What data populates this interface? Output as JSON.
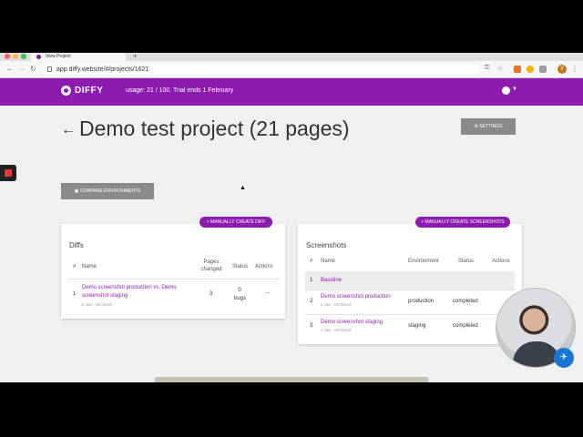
{
  "browser": {
    "tab_title": "View Project",
    "new_tab": "+",
    "url": "app.diffy.website/#/projects/1621",
    "profile_initial": "Y"
  },
  "appbar": {
    "brand": "DIFFY",
    "usage": "usage: 21 / 100. Trial ends 1 February"
  },
  "page": {
    "back": "←",
    "title": "Demo test project (21 pages)",
    "settings_label": "⚙ SETTINGS",
    "compare_label": "▣ COMPARE ENVIRONMENTS"
  },
  "diffs": {
    "create_label": "+ MANUALLY CREATE DIFF",
    "title": "Diffs",
    "headers": {
      "num": "#",
      "name": "Name",
      "pages": "Pages changed",
      "status": "Status",
      "actions": "Actions"
    },
    "rows": [
      {
        "num": "1",
        "name": "Demo screenshot production vs. Demo screenshot staging",
        "date": "2 Jan - 06:53AM",
        "pages": "3",
        "status": "0 bugs",
        "actions": "..."
      }
    ]
  },
  "screenshots": {
    "create_label": "+ MANUALLY CREATE SCREENSHOTS",
    "title": "Screenshots",
    "headers": {
      "num": "#",
      "name": "Name",
      "environment": "Environment",
      "status": "Status",
      "actions": "Actions"
    },
    "rows": [
      {
        "num": "1",
        "name": "Baseline",
        "date": "",
        "environment": "",
        "status": ""
      },
      {
        "num": "2",
        "name": "Demo screenshot production",
        "date": "2 Jan - 06:53AM",
        "environment": "production",
        "status": "completed"
      },
      {
        "num": "3",
        "name": "Demo screenshot staging",
        "date": "2 Jan - 06:53AM",
        "environment": "staging",
        "status": "completed"
      }
    ]
  },
  "colors": {
    "brand": "#8e1bb0",
    "button_gray": "#8a8a8a",
    "page_bg": "#f0f0f0"
  }
}
